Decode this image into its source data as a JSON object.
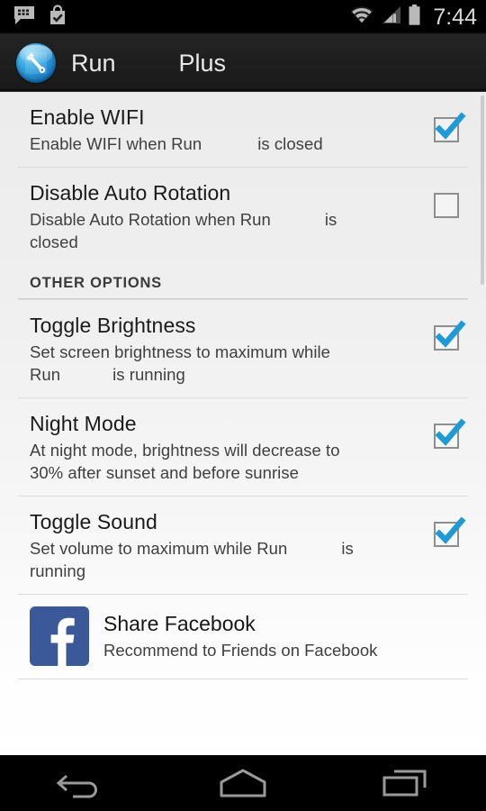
{
  "statusbar": {
    "time": "7:44",
    "icons": [
      "bbm-chat-icon",
      "play-store-bag-icon",
      "wifi-icon",
      "cellular-signal-icon",
      "battery-icon"
    ]
  },
  "actionbar": {
    "app_icon": "wrench-tool-icon",
    "title": "Run",
    "title_suffix": "Plus"
  },
  "preferences": [
    {
      "name": "enable-wifi",
      "title": "Enable WIFI",
      "summary_a": "Enable WIFI when Run",
      "summary_b": "is closed",
      "checked": true
    },
    {
      "name": "disable-auto-rotation",
      "title": "Disable Auto Rotation",
      "summary_a": "Disable Auto Rotation when Run",
      "summary_b": "is",
      "summary_c": "closed",
      "checked": false
    }
  ],
  "section": {
    "header": "OTHER OPTIONS"
  },
  "other_options": [
    {
      "name": "toggle-brightness",
      "title": "Toggle Brightness",
      "summary_a": "Set screen brightness to maximum while",
      "summary_b": "Run",
      "summary_c": "is running",
      "checked": true
    },
    {
      "name": "night-mode",
      "title": "Night Mode",
      "summary_a": "At night mode, brightness will decrease to",
      "summary_b": "30% after sunset and before sunrise",
      "checked": true
    },
    {
      "name": "toggle-sound",
      "title": "Toggle Sound",
      "summary_a": "Set volume to maximum while Run",
      "summary_b": "is",
      "summary_c": "running",
      "checked": true
    }
  ],
  "facebook": {
    "icon": "facebook-logo-icon",
    "title": "Share Facebook",
    "subtitle": "Recommend to Friends on Facebook"
  },
  "navbar": {
    "back": "back-icon",
    "home": "home-icon",
    "recents": "recents-icon"
  },
  "colors": {
    "accent_blue": "#1e9bd7",
    "facebook_blue": "#3b5998",
    "actionbar": "#1f1f1f",
    "list_bg": "#efefef"
  }
}
